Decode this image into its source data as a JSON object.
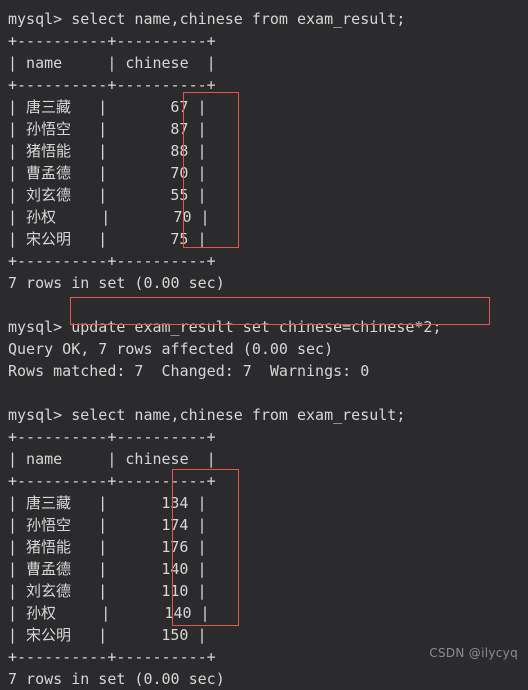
{
  "terminal": {
    "prompt": "mysql>",
    "background_color": "#2b2b2d",
    "text_color": "#d6d6d6",
    "highlight_color": "#e8544c"
  },
  "block1": {
    "command_line": "mysql> select name,chinese from exam_result;",
    "separator": "+----------+----------+",
    "header_row": "| name     | chinese  |",
    "rows": [
      "| 唐三藏   |       67 |",
      "| 孙悟空   |       87 |",
      "| 猪悟能   |       88 |",
      "| 曹孟德   |       70 |",
      "| 刘玄德   |       55 |",
      "| 孙权     |       70 |",
      "| 宋公明   |       75 |"
    ],
    "footer": "7 rows in set (0.00 sec)"
  },
  "block2": {
    "command_line": "mysql> update exam_result set chinese=chinese*2;",
    "result_line": "Query OK, 7 rows affected (0.00 sec)",
    "matched_line": "Rows matched: 7  Changed: 7  Warnings: 0"
  },
  "block3": {
    "command_line": "mysql> select name,chinese from exam_result;",
    "separator": "+----------+----------+",
    "header_row": "| name     | chinese  |",
    "rows": [
      "| 唐三藏   |      134 |",
      "| 孙悟空   |      174 |",
      "| 猪悟能   |      176 |",
      "| 曹孟德   |      140 |",
      "| 刘玄德   |      110 |",
      "| 孙权     |      140 |",
      "| 宋公明   |      150 |"
    ],
    "footer": "7 rows in set (0.00 sec)"
  },
  "table_data": {
    "columns": [
      "name",
      "chinese"
    ],
    "before_update": [
      {
        "name": "唐三藏",
        "chinese": 67
      },
      {
        "name": "孙悟空",
        "chinese": 87
      },
      {
        "name": "猪悟能",
        "chinese": 88
      },
      {
        "name": "曹孟德",
        "chinese": 70
      },
      {
        "name": "刘玄德",
        "chinese": 55
      },
      {
        "name": "孙权",
        "chinese": 70
      },
      {
        "name": "宋公明",
        "chinese": 75
      }
    ],
    "after_update": [
      {
        "name": "唐三藏",
        "chinese": 134
      },
      {
        "name": "孙悟空",
        "chinese": 174
      },
      {
        "name": "猪悟能",
        "chinese": 176
      },
      {
        "name": "曹孟德",
        "chinese": 140
      },
      {
        "name": "刘玄德",
        "chinese": 110
      },
      {
        "name": "孙权",
        "chinese": 140
      },
      {
        "name": "宋公明",
        "chinese": 150
      }
    ]
  },
  "watermark": "CSDN @ilycyq"
}
